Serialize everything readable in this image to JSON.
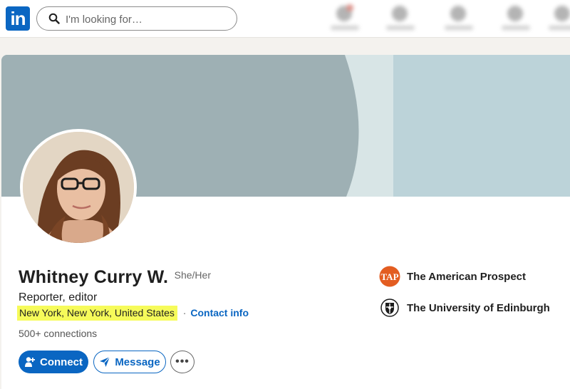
{
  "nav": {
    "logo_text": "in",
    "search_placeholder": "I'm looking for…"
  },
  "profile": {
    "name": "Whitney Curry W.",
    "pronouns": "She/Her",
    "headline": "Reporter, editor",
    "location": "New York, New York, United States",
    "separator": "·",
    "contact_info": "Contact info",
    "connections": "500+ connections"
  },
  "actions": {
    "connect_label": "Connect",
    "message_label": "Message",
    "more_label": "•••"
  },
  "experience": [
    {
      "name": "The American Prospect",
      "logo_text": "TAP"
    },
    {
      "name": "The University of Edinburgh"
    }
  ],
  "colors": {
    "brand": "#0a66c2",
    "location_highlight": "#f6fb5a",
    "cover_dark": "#9eb0b4",
    "cover_light": "#bcd3d9",
    "tap_orange": "#e35d21"
  }
}
